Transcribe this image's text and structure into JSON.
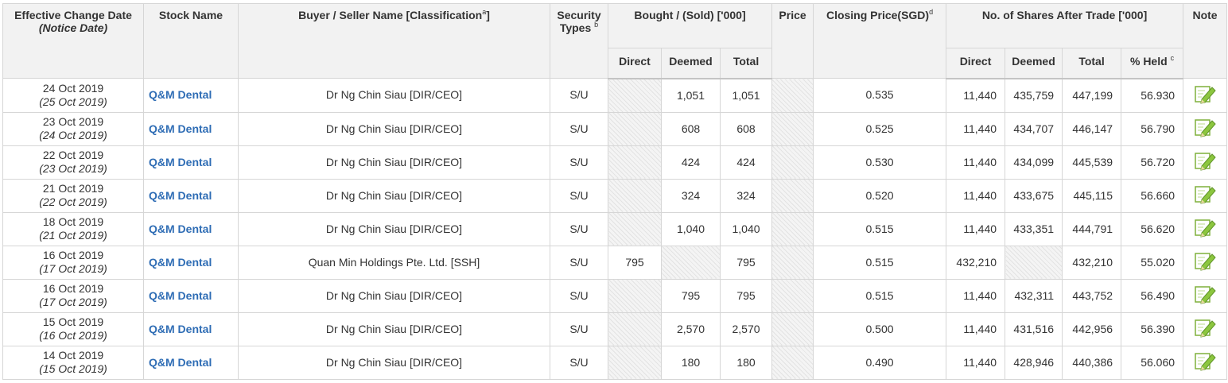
{
  "headers": {
    "effective_date": "Effective Change Date",
    "notice_date": "(Notice Date)",
    "stock_name": "Stock Name",
    "buyer_seller": "Buyer / Seller Name [Classification",
    "buyer_seller_sup": "a",
    "security_types": "Security Types",
    "security_types_sup": "b",
    "bought_sold": "Bought / (Sold) ['000]",
    "price": "Price",
    "closing_price": "Closing Price(SGD)",
    "closing_price_sup": "d",
    "shares_after": "No. of Shares After Trade ['000]",
    "note": "Note",
    "direct": "Direct",
    "deemed": "Deemed",
    "total": "Total",
    "pct_held": "% Held",
    "pct_held_sup": "c"
  },
  "rows": [
    {
      "date": "24 Oct 2019",
      "notice": "(25 Oct 2019)",
      "stock": "Q&M Dental",
      "party": "Dr Ng Chin Siau [DIR/CEO]",
      "type": "S/U",
      "b_direct": "",
      "b_deemed": "1,051",
      "b_total": "1,051",
      "price": "",
      "closing": "0.535",
      "s_direct": "11,440",
      "s_deemed": "435,759",
      "s_total": "447,199",
      "pct": "56.930"
    },
    {
      "date": "23 Oct 2019",
      "notice": "(24 Oct 2019)",
      "stock": "Q&M Dental",
      "party": "Dr Ng Chin Siau [DIR/CEO]",
      "type": "S/U",
      "b_direct": "",
      "b_deemed": "608",
      "b_total": "608",
      "price": "",
      "closing": "0.525",
      "s_direct": "11,440",
      "s_deemed": "434,707",
      "s_total": "446,147",
      "pct": "56.790"
    },
    {
      "date": "22 Oct 2019",
      "notice": "(23 Oct 2019)",
      "stock": "Q&M Dental",
      "party": "Dr Ng Chin Siau [DIR/CEO]",
      "type": "S/U",
      "b_direct": "",
      "b_deemed": "424",
      "b_total": "424",
      "price": "",
      "closing": "0.530",
      "s_direct": "11,440",
      "s_deemed": "434,099",
      "s_total": "445,539",
      "pct": "56.720"
    },
    {
      "date": "21 Oct 2019",
      "notice": "(22 Oct 2019)",
      "stock": "Q&M Dental",
      "party": "Dr Ng Chin Siau [DIR/CEO]",
      "type": "S/U",
      "b_direct": "",
      "b_deemed": "324",
      "b_total": "324",
      "price": "",
      "closing": "0.520",
      "s_direct": "11,440",
      "s_deemed": "433,675",
      "s_total": "445,115",
      "pct": "56.660"
    },
    {
      "date": "18 Oct 2019",
      "notice": "(21 Oct 2019)",
      "stock": "Q&M Dental",
      "party": "Dr Ng Chin Siau [DIR/CEO]",
      "type": "S/U",
      "b_direct": "",
      "b_deemed": "1,040",
      "b_total": "1,040",
      "price": "",
      "closing": "0.515",
      "s_direct": "11,440",
      "s_deemed": "433,351",
      "s_total": "444,791",
      "pct": "56.620"
    },
    {
      "date": "16 Oct 2019",
      "notice": "(17 Oct 2019)",
      "stock": "Q&M Dental",
      "party": "Quan Min Holdings Pte. Ltd. [SSH]",
      "type": "S/U",
      "b_direct": "795",
      "b_deemed": "",
      "b_total": "795",
      "price": "",
      "closing": "0.515",
      "s_direct": "432,210",
      "s_deemed": "",
      "s_total": "432,210",
      "pct": "55.020"
    },
    {
      "date": "16 Oct 2019",
      "notice": "(17 Oct 2019)",
      "stock": "Q&M Dental",
      "party": "Dr Ng Chin Siau [DIR/CEO]",
      "type": "S/U",
      "b_direct": "",
      "b_deemed": "795",
      "b_total": "795",
      "price": "",
      "closing": "0.515",
      "s_direct": "11,440",
      "s_deemed": "432,311",
      "s_total": "443,752",
      "pct": "56.490"
    },
    {
      "date": "15 Oct 2019",
      "notice": "(16 Oct 2019)",
      "stock": "Q&M Dental",
      "party": "Dr Ng Chin Siau [DIR/CEO]",
      "type": "S/U",
      "b_direct": "",
      "b_deemed": "2,570",
      "b_total": "2,570",
      "price": "",
      "closing": "0.500",
      "s_direct": "11,440",
      "s_deemed": "431,516",
      "s_total": "442,956",
      "pct": "56.390"
    },
    {
      "date": "14 Oct 2019",
      "notice": "(15 Oct 2019)",
      "stock": "Q&M Dental",
      "party": "Dr Ng Chin Siau [DIR/CEO]",
      "type": "S/U",
      "b_direct": "",
      "b_deemed": "180",
      "b_total": "180",
      "price": "",
      "closing": "0.490",
      "s_direct": "11,440",
      "s_deemed": "428,946",
      "s_total": "440,386",
      "pct": "56.060"
    }
  ],
  "icons": {
    "note": "edit-pencil-icon"
  },
  "colors": {
    "stock_link": "#2f6db5",
    "header_bg": "#f2f2f2",
    "icon_green": "#8cc63f"
  }
}
